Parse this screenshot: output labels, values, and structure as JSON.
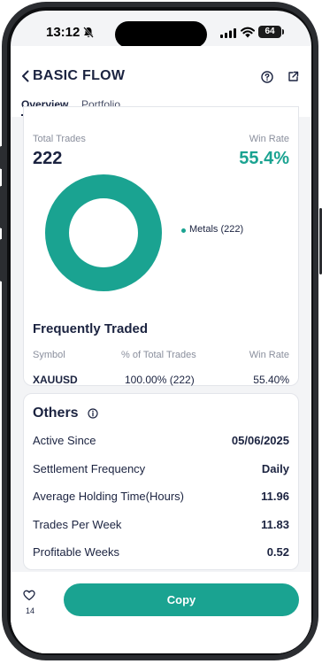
{
  "status_bar": {
    "time": "13:12",
    "battery": "64"
  },
  "header": {
    "title": "BASIC FLOW",
    "tabs": [
      {
        "label": "Overview",
        "active": true
      },
      {
        "label": "Portfolio",
        "active": false
      }
    ]
  },
  "stats": {
    "total_trades_label": "Total Trades",
    "total_trades": "222",
    "win_rate_label": "Win Rate",
    "win_rate": "55.4%"
  },
  "chart_data": {
    "type": "pie",
    "style": "donut",
    "labels": [
      "Metals (222)"
    ],
    "values": [
      222
    ],
    "colors": [
      "#1aa391"
    ],
    "legend": "right"
  },
  "frequently_traded": {
    "title": "Frequently Traded",
    "columns": [
      "Symbol",
      "% of Total Trades",
      "Win Rate"
    ],
    "rows": [
      {
        "symbol": "XAUUSD",
        "pct": "100.00% (222)",
        "win_rate": "55.40%"
      }
    ]
  },
  "others": {
    "title": "Others",
    "items": [
      {
        "label": "Active Since",
        "value": "05/06/2025"
      },
      {
        "label": "Settlement Frequency",
        "value": "Daily"
      },
      {
        "label": "Average Holding Time(Hours)",
        "value": "11.96"
      },
      {
        "label": "Trades Per Week",
        "value": "11.83"
      },
      {
        "label": "Profitable Weeks",
        "value": "0.52"
      }
    ]
  },
  "footer": {
    "likes": "14",
    "copy_label": "Copy"
  },
  "colors": {
    "accent": "#1aa391",
    "text": "#1b2340",
    "muted": "#8a8f9d"
  }
}
